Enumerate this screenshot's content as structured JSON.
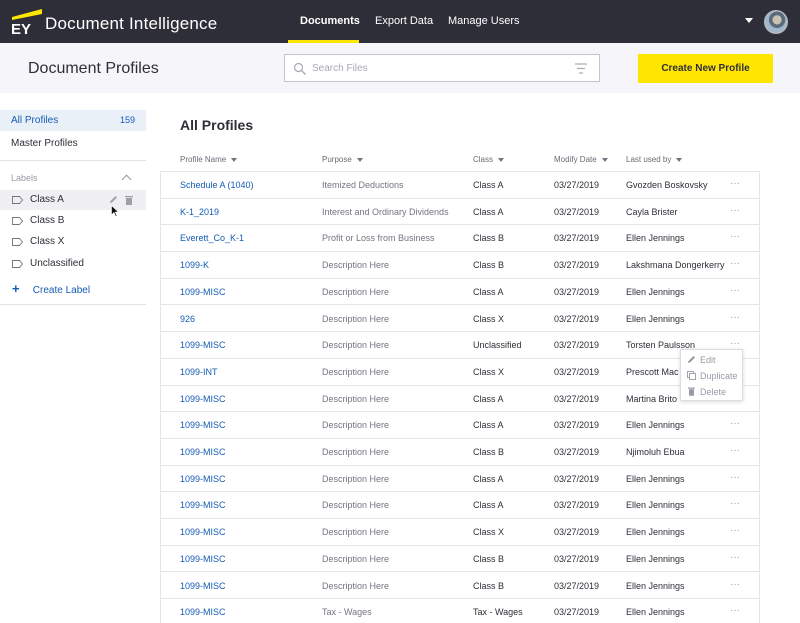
{
  "app": {
    "logo_text": "EY",
    "title": "Document Intelligence"
  },
  "nav": {
    "tabs": [
      {
        "label": "Documents",
        "active": true
      },
      {
        "label": "Export Data",
        "active": false
      },
      {
        "label": "Manage Users",
        "active": false
      }
    ]
  },
  "header": {
    "page_title": "Document Profiles",
    "search_placeholder": "Search Files",
    "create_button": "Create New Profile"
  },
  "sidebar": {
    "all_profiles": {
      "label": "All Profiles",
      "count": "159"
    },
    "master_profiles": "Master Profiles",
    "labels_heading": "Labels",
    "labels": [
      "Class A",
      "Class B",
      "Class X",
      "Unclassified"
    ],
    "create_label": "Create Label"
  },
  "main": {
    "title": "All Profiles",
    "columns": [
      "Profile Name",
      "Purpose",
      "Class",
      "Modify Date",
      "Last used by"
    ],
    "rows": [
      [
        "Schedule A (1040)",
        "Itemized Deductions",
        "Class A",
        "03/27/2019",
        "Gvozden Boskovsky"
      ],
      [
        "K-1_2019",
        "Interest and Ordinary Dividends",
        "Class A",
        "03/27/2019",
        "Cayla Brister"
      ],
      [
        "Everett_Co_K-1",
        "Profit or Loss from Business",
        "Class B",
        "03/27/2019",
        "Ellen Jennings"
      ],
      [
        "1099-K",
        "Description Here",
        "Class B",
        "03/27/2019",
        "Lakshmana Dongerkerry"
      ],
      [
        "1099-MISC",
        "Description Here",
        "Class A",
        "03/27/2019",
        "Ellen Jennings"
      ],
      [
        "926",
        "Description Here",
        "Class X",
        "03/27/2019",
        "Ellen Jennings"
      ],
      [
        "1099-MISC",
        "Description Here",
        "Unclassified",
        "03/27/2019",
        "Torsten Paulsson"
      ],
      [
        "1099-INT",
        "Description Here",
        "Class X",
        "03/27/2019",
        "Prescott Mac"
      ],
      [
        "1099-MISC",
        "Description Here",
        "Class A",
        "03/27/2019",
        "Martina Brito"
      ],
      [
        "1099-MISC",
        "Description Here",
        "Class A",
        "03/27/2019",
        "Ellen Jennings"
      ],
      [
        "1099-MISC",
        "Description Here",
        "Class B",
        "03/27/2019",
        "Njimoluh Ebua"
      ],
      [
        "1099-MISC",
        "Description Here",
        "Class A",
        "03/27/2019",
        "Ellen Jennings"
      ],
      [
        "1099-MISC",
        "Description Here",
        "Class A",
        "03/27/2019",
        "Ellen Jennings"
      ],
      [
        "1099-MISC",
        "Description Here",
        "Class X",
        "03/27/2019",
        "Ellen Jennings"
      ],
      [
        "1099-MISC",
        "Description Here",
        "Class B",
        "03/27/2019",
        "Ellen Jennings"
      ],
      [
        "1099-MISC",
        "Description Here",
        "Class B",
        "03/27/2019",
        "Ellen Jennings"
      ],
      [
        "1099-MISC",
        "Tax - Wages",
        "Tax - Wages",
        "03/27/2019",
        "Ellen Jennings"
      ]
    ],
    "row_menu_glyph": "···"
  },
  "context_menu": {
    "items": [
      "Edit",
      "Duplicate",
      "Delete"
    ]
  },
  "colors": {
    "nav_bg": "#2e2e38",
    "accent_yellow": "#ffe600",
    "link_blue": "#155cb4"
  }
}
